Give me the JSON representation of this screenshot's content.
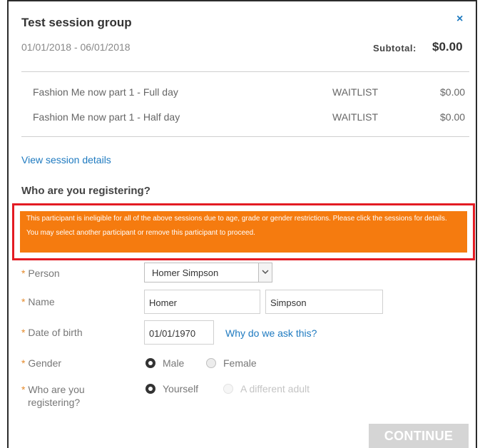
{
  "header": {
    "title": "Test session group",
    "close_glyph": "×",
    "date_range": "01/01/2018 - 06/01/2018",
    "subtotal_label": "Subtotal:",
    "subtotal_value": "$0.00"
  },
  "sessions": [
    {
      "name": "Fashion Me now part 1 - Full day",
      "status": "WAITLIST",
      "price": "$0.00"
    },
    {
      "name": "Fashion Me now part 1 - Half day",
      "status": "WAITLIST",
      "price": "$0.00"
    }
  ],
  "view_details_link": "View session details",
  "section_heading": "Who are you registering?",
  "alert": {
    "message": "This participant is ineligible for all of the above sessions due to age, grade or gender restrictions. Please click the sessions for details. You may select another participant or remove this participant to proceed.",
    "color": "#f57b0f",
    "highlight_border": "#e31b23"
  },
  "form": {
    "required_mark": "*",
    "person": {
      "label": "Person",
      "value": "Homer Simpson"
    },
    "name": {
      "label": "Name",
      "first": "Homer",
      "last": "Simpson"
    },
    "dob": {
      "label": "Date of birth",
      "value": "01/01/1970",
      "help_link": "Why do we ask this?"
    },
    "gender": {
      "label": "Gender",
      "options": [
        "Male",
        "Female"
      ],
      "selected": "Male"
    },
    "registering": {
      "label_line1": "Who are you",
      "label_line2": "registering?",
      "options": [
        "Yourself",
        "A different adult"
      ],
      "selected": "Yourself"
    }
  },
  "continue_button": "CONTINUE"
}
